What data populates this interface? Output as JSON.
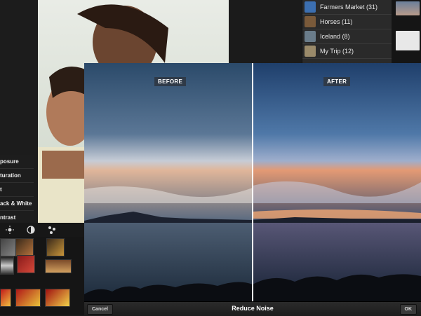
{
  "albums": [
    {
      "label": "Farmers Market (31)",
      "thumb_color": "#3c6fb0"
    },
    {
      "label": "Horses (11)",
      "thumb_color": "#7a5a3a"
    },
    {
      "label": "Iceland (8)",
      "thumb_color": "#6a7c8a"
    },
    {
      "label": "My Trip (12)",
      "thumb_color": "#9a8a6a"
    }
  ],
  "adjust_menu": {
    "items": [
      "posure",
      "turation",
      "t",
      "ack & White",
      "ntrast"
    ]
  },
  "tools": {
    "icons": [
      "brightness-icon",
      "contrast-circle-icon",
      "effects-icon"
    ]
  },
  "compare": {
    "before_label": "BEFORE",
    "after_label": "AFTER"
  },
  "bottom_bar": {
    "cancel_label": "Cancel",
    "title": "Reduce Noise",
    "ok_label": "OK"
  }
}
